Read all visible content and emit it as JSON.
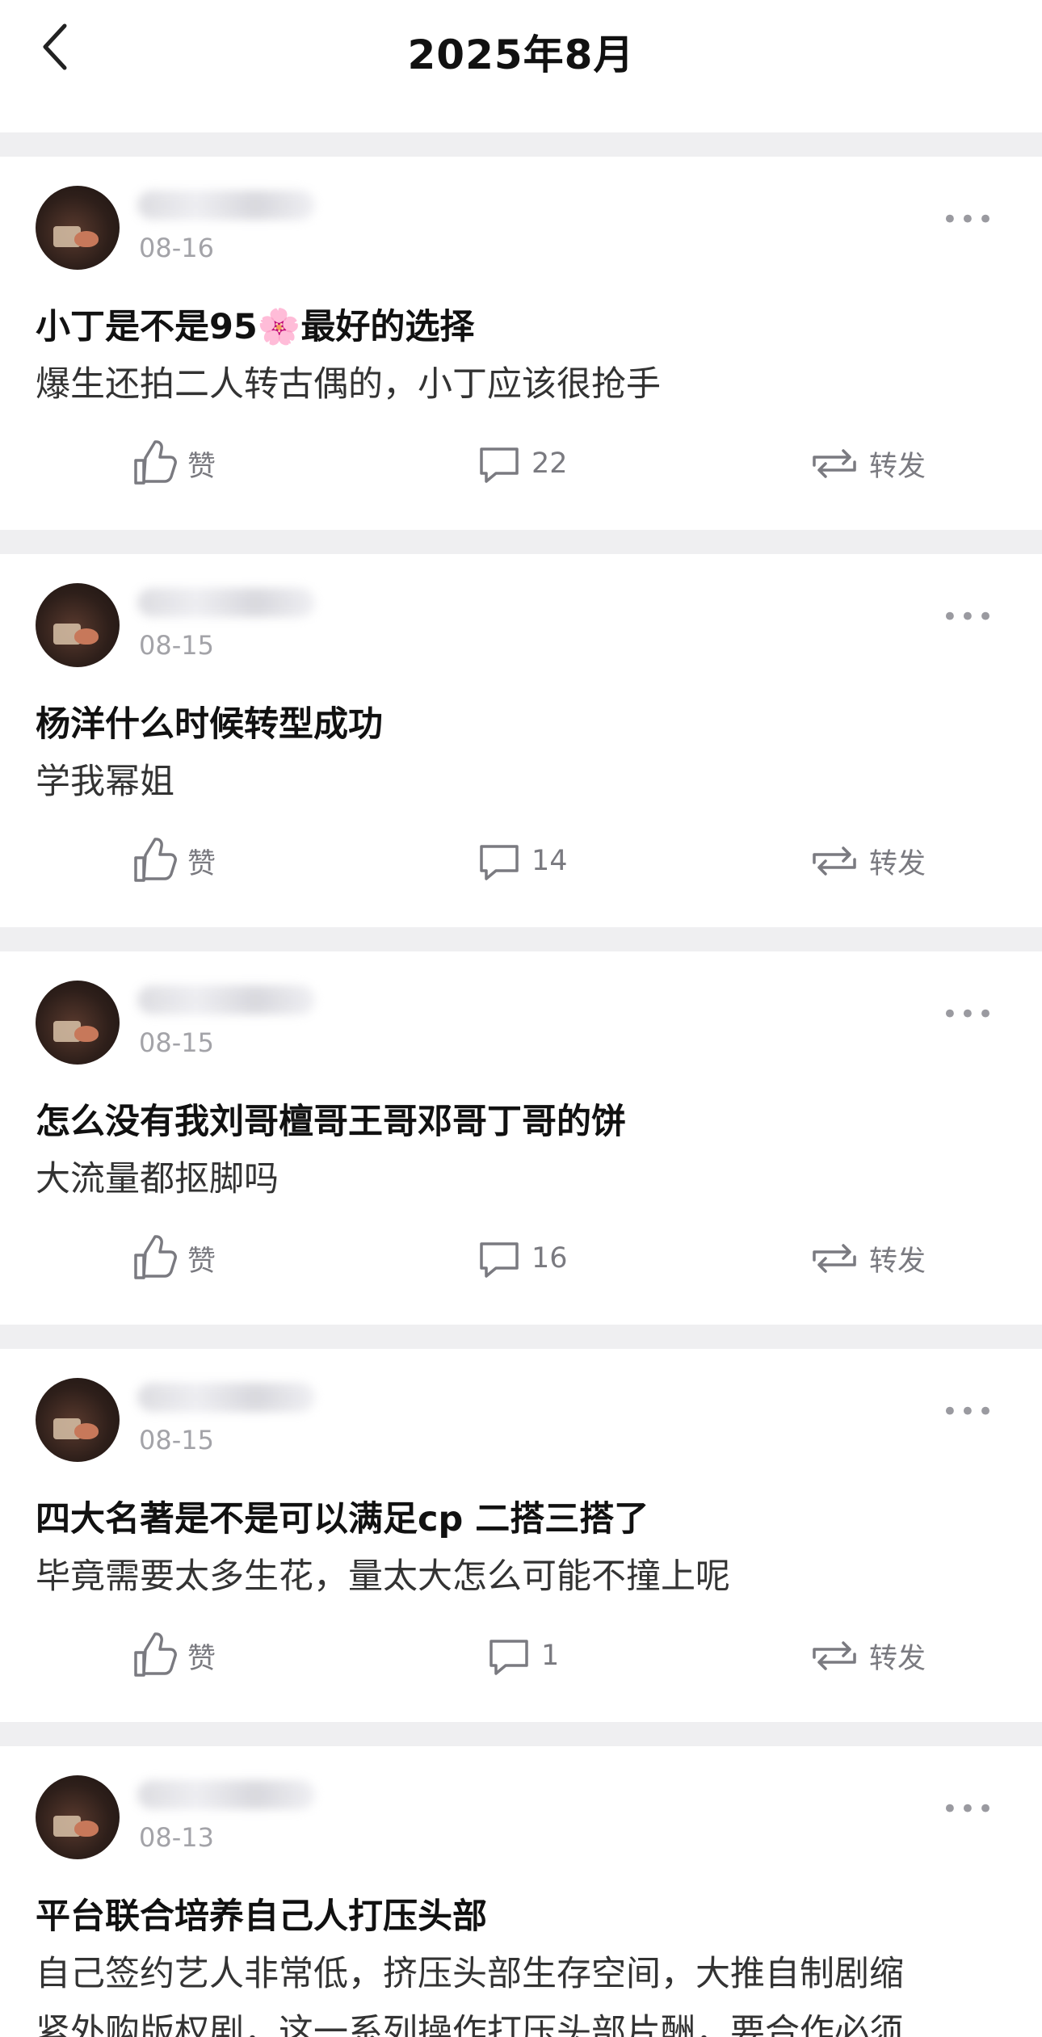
{
  "header": {
    "title": "2025年8月",
    "back_icon": "chevron-left-icon"
  },
  "labels": {
    "like": "赞",
    "repost": "转发",
    "more": "•••"
  },
  "posts": [
    {
      "date": "08-16",
      "title": "小丁是不是95🌸最好的选择",
      "body": "爆生还拍二人转古偶的，小丁应该很抢手",
      "comments": "22"
    },
    {
      "date": "08-15",
      "title": "杨洋什么时候转型成功",
      "body": "学我幂姐",
      "comments": "14"
    },
    {
      "date": "08-15",
      "title": "怎么没有我刘哥檀哥王哥邓哥丁哥的饼",
      "body": "大流量都抠脚吗",
      "comments": "16"
    },
    {
      "date": "08-15",
      "title": "四大名著是不是可以满足cp 二搭三搭了",
      "body": "毕竟需要太多生花，量太大怎么可能不撞上呢",
      "comments": "1"
    },
    {
      "date": "08-13",
      "title": "平台联合培养自己人打压头部",
      "body": "自己签约艺人非常低，挤压头部生存空间，大推自制剧缩\n紧外购版权剧，这一系列操作打压头部片酬，要合作必须",
      "comments": ""
    }
  ],
  "colors": {
    "background": "#efeff1",
    "card": "#ffffff",
    "text": "#1a1a1a",
    "meta": "#a3a3a8"
  }
}
